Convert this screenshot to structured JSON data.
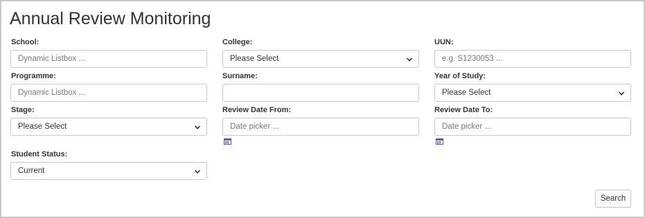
{
  "page": {
    "title": "Annual Review Monitoring"
  },
  "form": {
    "school": {
      "label": "School:",
      "placeholder": "Dynamic Listbox ..."
    },
    "college": {
      "label": "College:",
      "value": "Please Select"
    },
    "uun": {
      "label": "UUN:",
      "placeholder": "e.g. S1230053 ..."
    },
    "programme": {
      "label": "Programme:",
      "placeholder": "Dynamic Listbox ..."
    },
    "surname": {
      "label": "Surname:",
      "value": ""
    },
    "year_of_study": {
      "label": "Year of Study:",
      "value": "Please Select"
    },
    "stage": {
      "label": "Stage:",
      "value": "Please Select"
    },
    "review_date_from": {
      "label": "Review Date From:",
      "placeholder": "Date picker ..."
    },
    "review_date_to": {
      "label": "Review Date To:",
      "placeholder": "Date picker ..."
    },
    "student_status": {
      "label": "Student Status:",
      "value": "Current"
    }
  },
  "actions": {
    "search_label": "Search"
  },
  "icons": {
    "dropdown": "chevron-down-icon",
    "calendar": "calendar-icon"
  },
  "colors": {
    "calendar_blue": "#3d5fb5",
    "calendar_red": "#d33a3a"
  }
}
